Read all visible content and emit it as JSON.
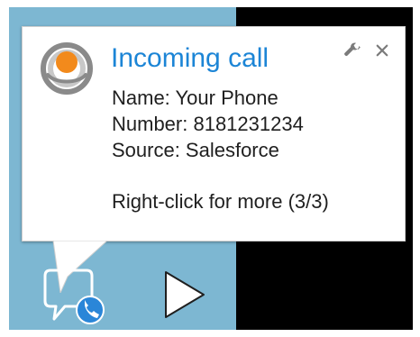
{
  "notification": {
    "title": "Incoming call",
    "name_line": "Name: Your Phone",
    "number_line": "Number: 8181231234",
    "source_line": "Source: Salesforce",
    "footer_line": "Right-click for more (3/3)"
  },
  "icons": {
    "logo": "app-logo-icon",
    "wrench": "wrench-icon",
    "close": "close-icon",
    "chat": "chat-phone-icon",
    "play": "play-icon"
  },
  "colors": {
    "title": "#1c85d6",
    "background_blue": "#7db7d2",
    "background_black": "#000000",
    "accent_orange": "#f28a1c",
    "icon_blue": "#2a86d8"
  }
}
